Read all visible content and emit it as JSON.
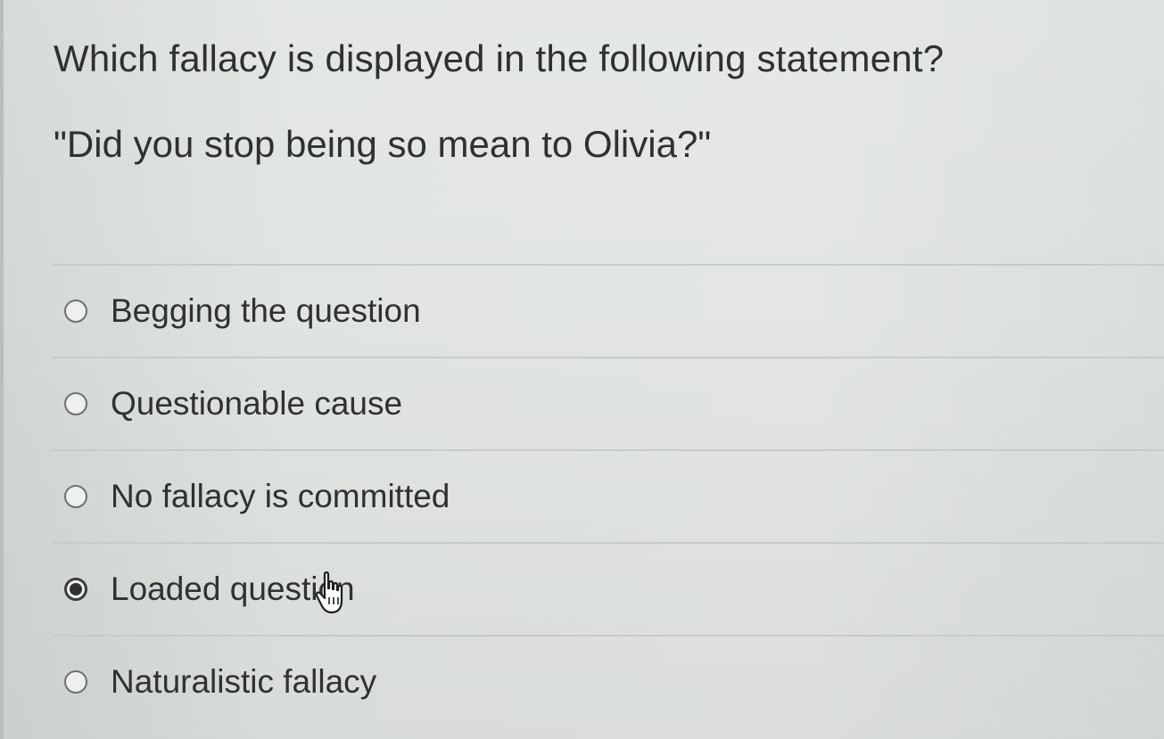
{
  "question": {
    "title": "Which fallacy is displayed in the following statement?",
    "statement": "\"Did you stop being so mean to Olivia?\""
  },
  "options": [
    {
      "label": "Begging the question",
      "selected": false
    },
    {
      "label": "Questionable cause",
      "selected": false
    },
    {
      "label": "No fallacy is committed",
      "selected": false
    },
    {
      "label": "Loaded question",
      "selected": true
    },
    {
      "label": "Naturalistic fallacy",
      "selected": false
    }
  ],
  "colors": {
    "background": "#dfe3e0",
    "text": "#2e3031",
    "divider": "#c6ccc8",
    "radio_border": "#6d7170"
  },
  "icons": {
    "radio_unchecked": "radio-unchecked-icon",
    "radio_checked": "radio-checked-icon",
    "pointer": "hand-pointer-cursor-icon"
  }
}
